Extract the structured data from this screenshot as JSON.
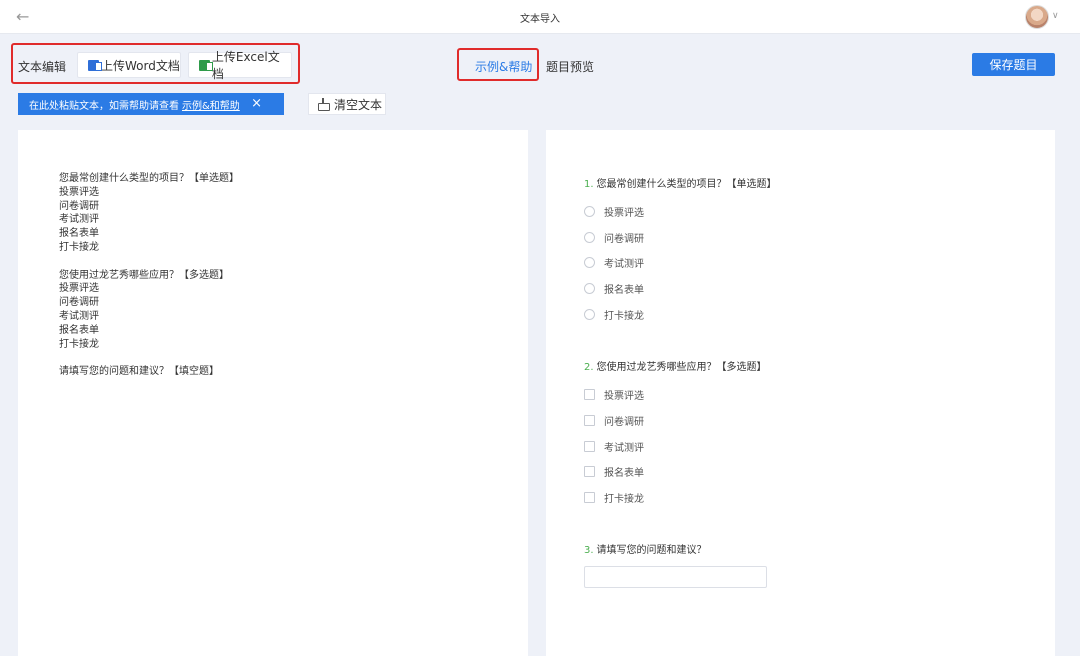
{
  "header": {
    "title": "文本导入",
    "back_icon": "←",
    "chevron": "∨"
  },
  "toolbar": {
    "edit_label": "文本编辑",
    "word_label": "上传Word文档",
    "excel_label": "上传Excel文档",
    "help_tab": "示例&帮助",
    "preview_tab": "题目预览",
    "save_label": "保存题目",
    "clear_label": "清空文本"
  },
  "notice": {
    "text": "在此处粘贴文本，如需帮助请查看",
    "link": "示例&和帮助",
    "close": "×"
  },
  "editor": {
    "lines": [
      "您最常创建什么类型的项目？【单选题】",
      "投票评选",
      "问卷调研",
      "考试测评",
      "报名表单",
      "打卡接龙",
      "",
      "您使用过龙艺秀哪些应用？【多选题】",
      "投票评选",
      "问卷调研",
      "考试测评",
      "报名表单",
      "打卡接龙",
      "",
      "请填写您的问题和建议？【填空题】"
    ]
  },
  "preview": {
    "q1": {
      "num": "1.",
      "title": "您最常创建什么类型的项目？【单选题】",
      "options": [
        "投票评选",
        "问卷调研",
        "考试测评",
        "报名表单",
        "打卡接龙"
      ]
    },
    "q2": {
      "num": "2.",
      "title": "您使用过龙艺秀哪些应用？【多选题】",
      "options": [
        "投票评选",
        "问卷调研",
        "考试测评",
        "报名表单",
        "打卡接龙"
      ]
    },
    "q3": {
      "num": "3.",
      "title": "请填写您的问题和建议？"
    }
  },
  "colors": {
    "accent": "#2b7be5",
    "highlight_box": "#e02b2b",
    "question_number": "#4caf50"
  }
}
